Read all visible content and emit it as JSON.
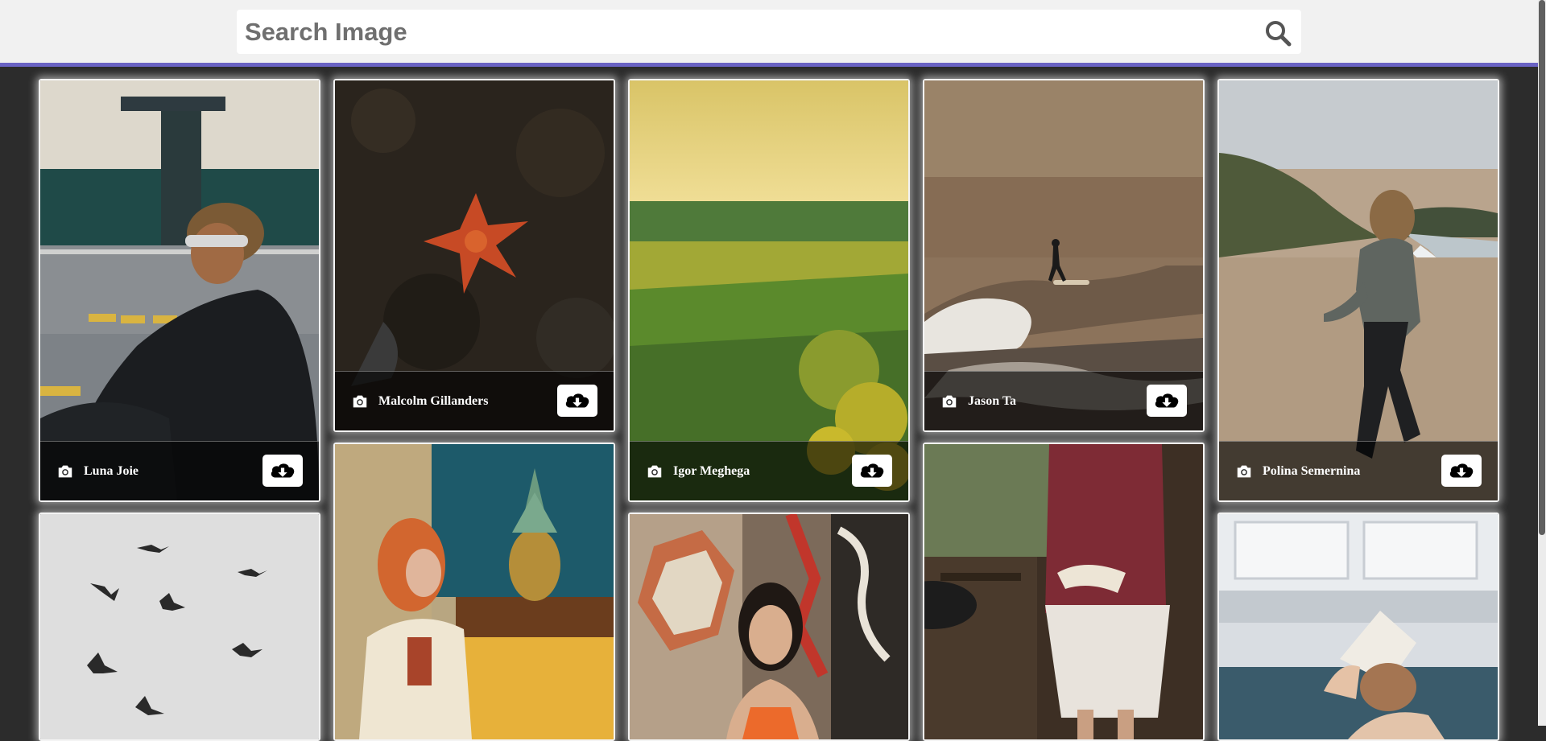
{
  "search": {
    "placeholder": "Search Image",
    "value": ""
  },
  "icons": {
    "search": "search-icon",
    "camera": "camera-icon",
    "download": "cloud-download-icon"
  },
  "colors": {
    "accent": "#6a63c4",
    "background": "#2c2c2c",
    "topbar": "#f1f1f1"
  },
  "images": [
    {
      "photographer": "Luna Joie",
      "subject": "person-sitting-street"
    },
    {
      "photographer": "Malcolm Gillanders",
      "subject": "starfish-on-rock"
    },
    {
      "photographer": "Igor Meghega",
      "subject": "green-field-sunset"
    },
    {
      "photographer": "Jason Ta",
      "subject": "surfer-waves"
    },
    {
      "photographer": "Polina Semernina",
      "subject": "woman-beach"
    },
    {
      "photographer": "",
      "subject": "birds-sky"
    },
    {
      "photographer": "",
      "subject": "woman-pineapple"
    },
    {
      "photographer": "",
      "subject": "woman-graffiti"
    },
    {
      "photographer": "",
      "subject": "woman-reading-window"
    },
    {
      "photographer": "",
      "subject": "woman-book-face"
    }
  ]
}
